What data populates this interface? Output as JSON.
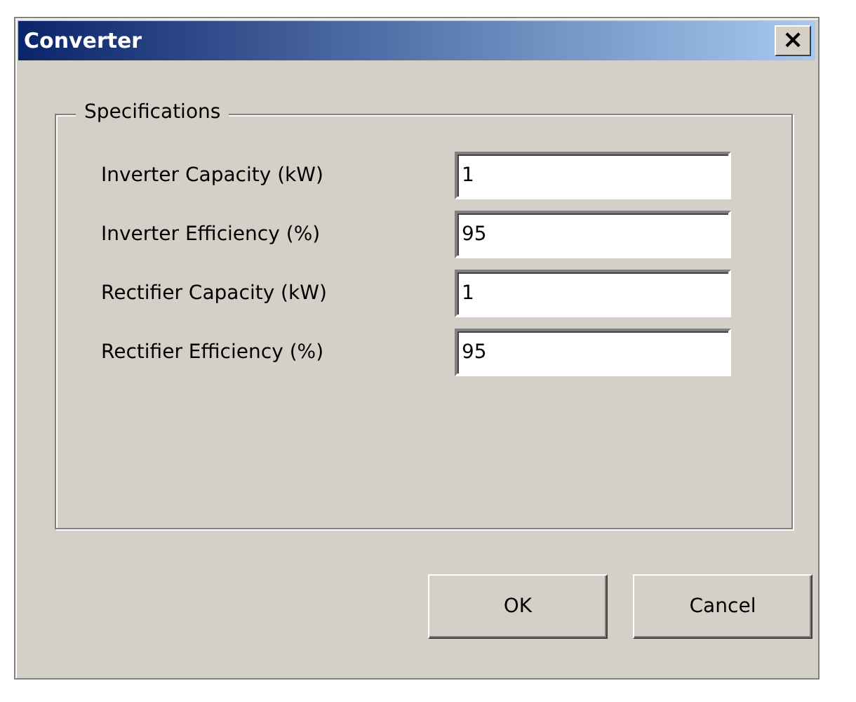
{
  "window": {
    "title": "Converter",
    "close": "×"
  },
  "group": {
    "title": "Specifications",
    "fields": [
      {
        "label": "Inverter Capacity (kW)",
        "value": "1"
      },
      {
        "label": "Inverter Efficiency (%)",
        "value": "95"
      },
      {
        "label": "Rectifier Capacity (kW)",
        "value": "1"
      },
      {
        "label": "Rectifier Efficiency (%)",
        "value": "95"
      }
    ]
  },
  "buttons": [
    "OK",
    "Cancel"
  ]
}
